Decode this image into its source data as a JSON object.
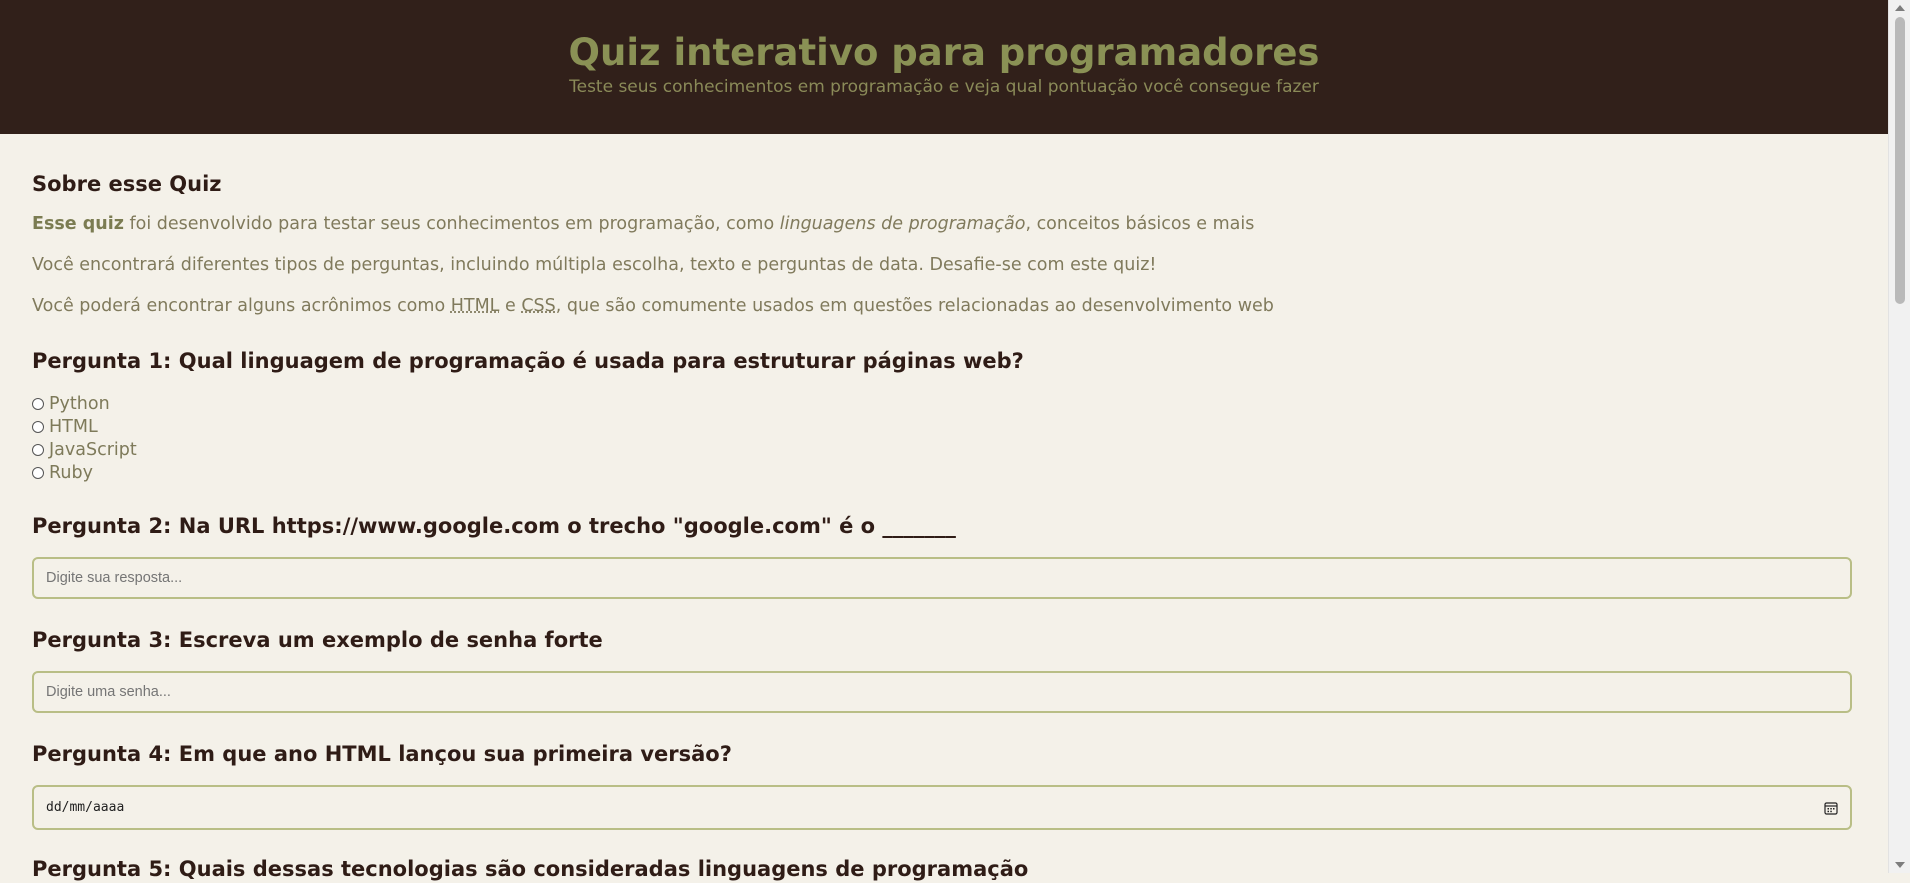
{
  "header": {
    "title": "Quiz interativo para programadores",
    "subtitle": "Teste seus conhecimentos em programação e veja qual pontuação você consegue fazer"
  },
  "about": {
    "heading": "Sobre esse Quiz",
    "p1_bold": "Esse quiz",
    "p1_text_a": " foi desenvolvido para testar seus conhecimentos em programação, como ",
    "p1_italic": "linguagens de programação",
    "p1_text_b": ", conceitos básicos e mais",
    "p2": "Você encontrará diferentes tipos de perguntas, incluindo múltipla escolha, texto e perguntas de data. Desafie-se com este quiz!",
    "p3_text_a": "Você poderá encontrar alguns acrônimos como ",
    "p3_abbr1": "HTML",
    "p3_text_b": " e ",
    "p3_abbr2": "CSS",
    "p3_text_c": ", que são comumente usados em questões relacionadas ao desenvolvimento web"
  },
  "questions": [
    {
      "label": "Pergunta 1: Qual linguagem de programação é usada para estruturar páginas web?",
      "options": [
        "Python",
        "HTML",
        "JavaScript",
        "Ruby"
      ]
    },
    {
      "label": "Pergunta 2: Na URL https://www.google.com o trecho \"google.com\" é o _______",
      "placeholder": "Digite sua resposta..."
    },
    {
      "label": "Pergunta 3: Escreva um exemplo de senha forte",
      "placeholder": "Digite uma senha..."
    },
    {
      "label": "Pergunta 4: Em que ano HTML lançou sua primeira versão?",
      "date_value": "dd/mm/aaaa"
    },
    {
      "label": "Pergunta 5: Quais dessas tecnologias são consideradas linguagens de programação"
    }
  ],
  "icons": {
    "date_picker": "calendar-icon"
  },
  "colors": {
    "header_bg": "#31201a",
    "title": "#8a9155",
    "page_bg": "#f4f1e9",
    "heading": "#2f1c16",
    "field_border": "#b9be86"
  }
}
